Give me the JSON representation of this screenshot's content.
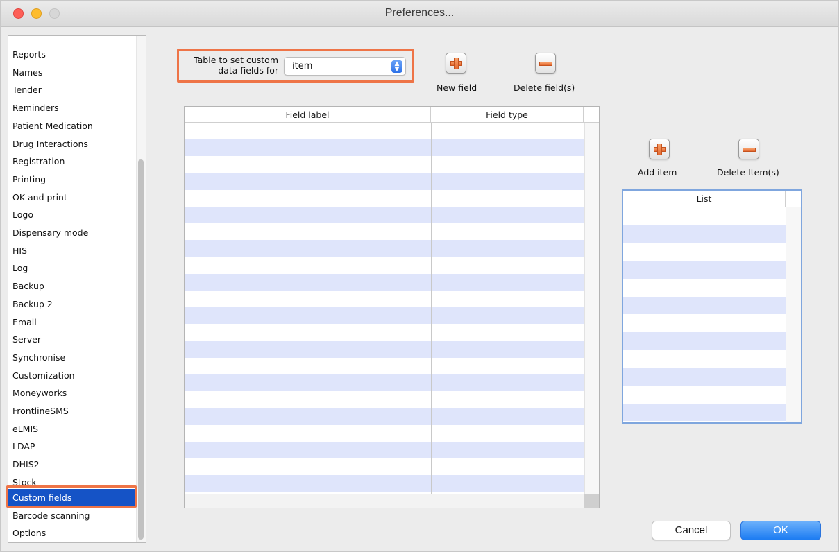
{
  "window": {
    "title": "Preferences..."
  },
  "sidebar": {
    "partial_top_item": "...",
    "items": [
      {
        "label": "Reports"
      },
      {
        "label": "Names"
      },
      {
        "label": "Tender"
      },
      {
        "label": "Reminders"
      },
      {
        "label": "Patient Medication"
      },
      {
        "label": "Drug Interactions"
      },
      {
        "label": "Registration"
      },
      {
        "label": "Printing"
      },
      {
        "label": "OK and print"
      },
      {
        "label": "Logo"
      },
      {
        "label": "Dispensary mode"
      },
      {
        "label": "HIS"
      },
      {
        "label": "Log"
      },
      {
        "label": "Backup"
      },
      {
        "label": "Backup 2"
      },
      {
        "label": "Email"
      },
      {
        "label": "Server"
      },
      {
        "label": "Synchronise"
      },
      {
        "label": "Customization"
      },
      {
        "label": "Moneyworks"
      },
      {
        "label": "FrontlineSMS"
      },
      {
        "label": "eLMIS"
      },
      {
        "label": "LDAP"
      },
      {
        "label": "DHIS2"
      },
      {
        "label": "Stock"
      },
      {
        "label": "Custom fields",
        "selected": true
      },
      {
        "label": "Barcode scanning"
      },
      {
        "label": "Options"
      }
    ]
  },
  "table_selector": {
    "label_line1": "Table to set custom",
    "label_line2": "data fields for",
    "value": "item"
  },
  "field_buttons": {
    "new_label": "New field",
    "delete_label": "Delete field(s)"
  },
  "fields_table": {
    "columns": [
      "Field label",
      "Field type"
    ],
    "rows": []
  },
  "list_buttons": {
    "add_label": "Add item",
    "delete_label": "Delete Item(s)"
  },
  "list_table": {
    "columns": [
      "List"
    ],
    "rows": []
  },
  "dialog": {
    "cancel_label": "Cancel",
    "ok_label": "OK"
  },
  "colors": {
    "selection": "#1553c6",
    "highlight_box": "#ee7447",
    "row_stripe": "#dfe5fb",
    "ok_button": "#1c7cf2"
  },
  "icons": [
    "plus-icon",
    "minus-icon",
    "chevron-up-down-icon"
  ]
}
